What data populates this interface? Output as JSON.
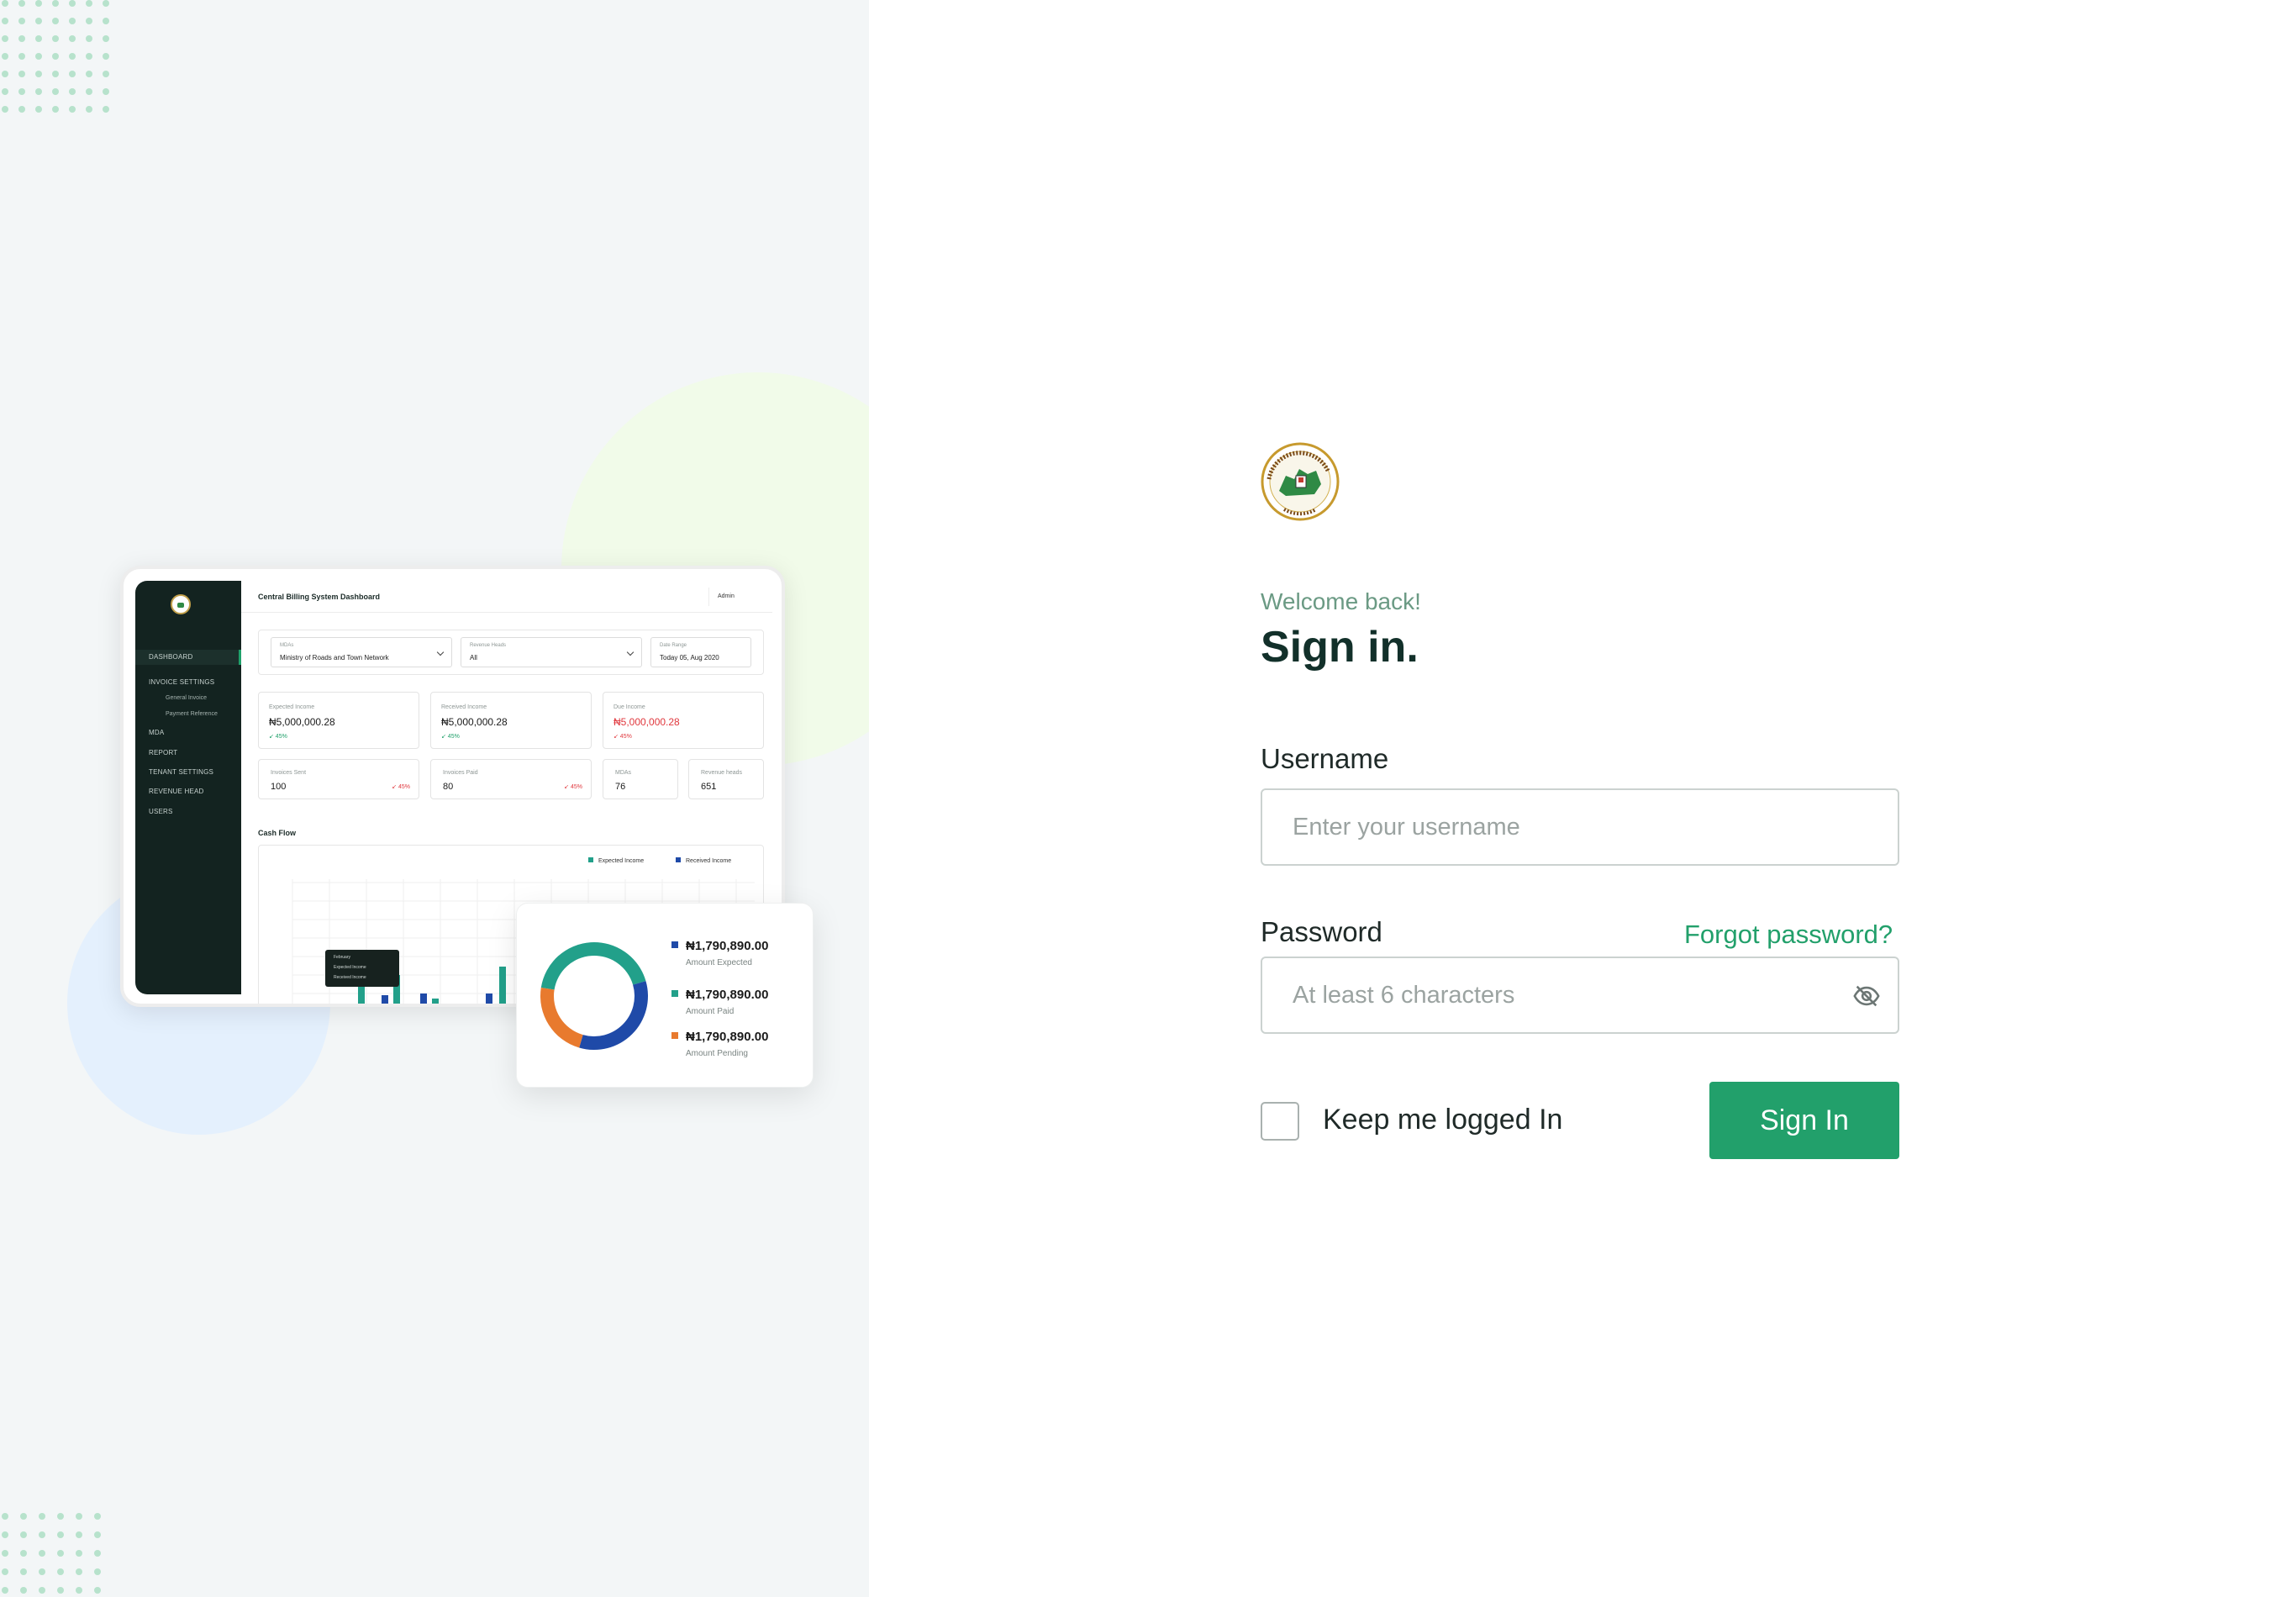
{
  "illustration": {
    "dashboard": {
      "title": "Central Billing System Dashboard",
      "admin_label": "Admin",
      "sidebar": {
        "items": [
          {
            "label": "DASHBOARD"
          },
          {
            "label": "INVOICE SETTINGS"
          },
          {
            "label": "General Invoice"
          },
          {
            "label": "Payment Reference"
          },
          {
            "label": "MDA"
          },
          {
            "label": "REPORT"
          },
          {
            "label": "TENANT SETTINGS"
          },
          {
            "label": "REVENUE HEAD"
          },
          {
            "label": "USERS"
          }
        ]
      },
      "filters": [
        {
          "label": "MDAs",
          "value": "Ministry of Roads and Town Network"
        },
        {
          "label": "Revenue Heads",
          "value": "All"
        },
        {
          "label": "Date Range",
          "value": "Today  05, Aug 2020"
        }
      ],
      "cards": [
        {
          "label": "Expected Income",
          "value": "₦5,000,000.28",
          "change": "↙ 45%"
        },
        {
          "label": "Received Income",
          "value": "₦5,000,000.28",
          "change": "↙ 45%"
        },
        {
          "label": "Due Income",
          "value": "₦5,000,000.28",
          "change": "↙ 45%"
        }
      ],
      "small_cards": [
        {
          "label": "Invoices Sent",
          "value": "100",
          "change": "↙ 45%"
        },
        {
          "label": "Invoices Paid",
          "value": "80",
          "change": "↙ 45%"
        },
        {
          "label": "MDAs",
          "value": "76"
        },
        {
          "label": "Revenue heads",
          "value": "651"
        }
      ],
      "cashflow": {
        "title": "Cash Flow",
        "legend": [
          "Expected Income",
          "Received Income"
        ],
        "tooltip": [
          "February",
          "Expected Income",
          "Received Income"
        ]
      }
    },
    "donut": {
      "items": [
        {
          "value": "₦1,790,890.00",
          "label": "Amount Expected",
          "color": "#1f4aa8",
          "share": 0.34
        },
        {
          "value": "₦1,790,890.00",
          "label": "Amount Paid",
          "color": "#22a08a",
          "share": 0.43
        },
        {
          "value": "₦1,790,890.00",
          "label": "Amount Pending",
          "color": "#e87a2e",
          "share": 0.23
        }
      ]
    }
  },
  "form": {
    "welcome": "Welcome back!",
    "title": "Sign in.",
    "username_label": "Username",
    "username_placeholder": "Enter your username",
    "password_label": "Password",
    "forgot_password": "Forgot password?",
    "password_placeholder": "At least 6 characters",
    "keep_logged_in": "Keep me logged In",
    "submit": "Sign In"
  },
  "colors": {
    "brand_green": "#22a06b",
    "title_dark": "#12302a",
    "welcome_green": "#6b9a84",
    "panel_bg": "#f3f6f7"
  }
}
